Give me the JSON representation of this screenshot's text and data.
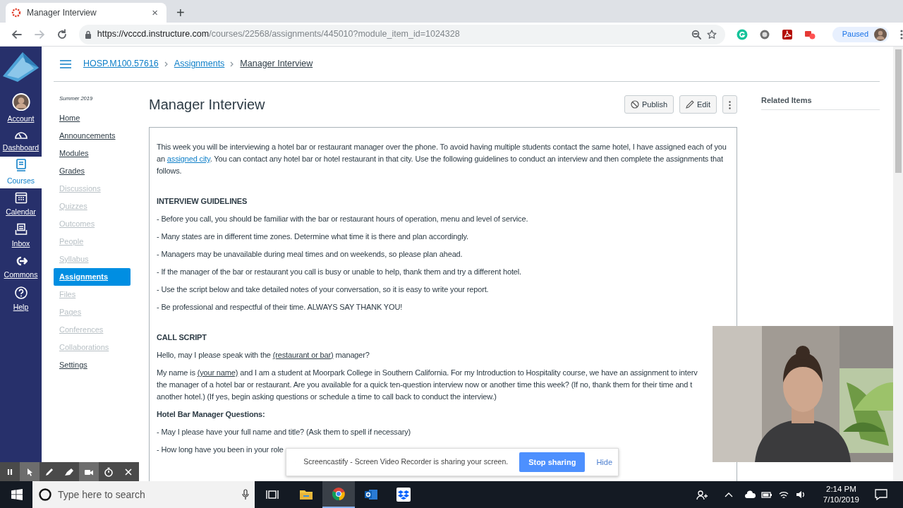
{
  "browser": {
    "tab": {
      "title": "Manager Interview",
      "close": "×"
    },
    "new_tab": "+",
    "url": {
      "host": "https://vcccd.instructure.com",
      "path": "/courses/22568/assignments/445010?module_item_id=1024328"
    },
    "profile_status": "Paused"
  },
  "global_nav": [
    {
      "label": "Account",
      "kind": "account",
      "selected": false
    },
    {
      "label": "Dashboard",
      "kind": "dashboard",
      "selected": false
    },
    {
      "label": "Courses",
      "kind": "courses",
      "selected": true
    },
    {
      "label": "Calendar",
      "kind": "calendar",
      "selected": false
    },
    {
      "label": "Inbox",
      "kind": "inbox",
      "selected": false
    },
    {
      "label": "Commons",
      "kind": "commons",
      "selected": false
    },
    {
      "label": "Help",
      "kind": "help",
      "selected": false
    }
  ],
  "breadcrumbs": [
    {
      "label": "HOSP.M100.57616",
      "current": false
    },
    {
      "label": "Assignments",
      "current": false
    },
    {
      "label": "Manager Interview",
      "current": true
    }
  ],
  "course_nav": {
    "term": "Summer 2019",
    "items": [
      {
        "label": "Home",
        "disabled": false,
        "selected": false
      },
      {
        "label": "Announcements",
        "disabled": false,
        "selected": false
      },
      {
        "label": "Modules",
        "disabled": false,
        "selected": false
      },
      {
        "label": "Grades",
        "disabled": false,
        "selected": false
      },
      {
        "label": "Discussions",
        "disabled": true,
        "selected": false
      },
      {
        "label": "Quizzes",
        "disabled": true,
        "selected": false
      },
      {
        "label": "Outcomes",
        "disabled": true,
        "selected": false
      },
      {
        "label": "People",
        "disabled": true,
        "selected": false
      },
      {
        "label": "Syllabus",
        "disabled": true,
        "selected": false
      },
      {
        "label": "Assignments",
        "disabled": false,
        "selected": true
      },
      {
        "label": "Files",
        "disabled": true,
        "selected": false
      },
      {
        "label": "Pages",
        "disabled": true,
        "selected": false
      },
      {
        "label": "Conferences",
        "disabled": true,
        "selected": false
      },
      {
        "label": "Collaborations",
        "disabled": true,
        "selected": false
      },
      {
        "label": "Settings",
        "disabled": false,
        "selected": false
      }
    ]
  },
  "assignment": {
    "title": "Manager Interview",
    "buttons": [
      {
        "kind": "publish",
        "label": "Publish"
      },
      {
        "kind": "edit",
        "label": "Edit"
      },
      {
        "kind": "more"
      }
    ],
    "body": [
      {
        "kind": "paragraph",
        "parts": [
          {
            "kind": "text",
            "text": "This week you will be interviewing a hotel bar or restaurant manager over the phone. To avoid having multiple students contact the same hotel, I have assigned each of you an "
          },
          {
            "kind": "link",
            "text": "assigned city"
          },
          {
            "kind": "text",
            "text": ". You can contact any hotel bar or hotel restaurant in that city. Use the following guidelines to conduct an interview and then complete the assignments that follows."
          }
        ]
      },
      {
        "kind": "section",
        "parts": [
          {
            "kind": "text",
            "text": "INTERVIEW GUIDELINES"
          }
        ]
      },
      {
        "kind": "item",
        "parts": [
          {
            "kind": "text",
            "text": "- Before you call, you should be familiar with the bar or restaurant hours of operation, menu and level of service."
          }
        ]
      },
      {
        "kind": "item",
        "parts": [
          {
            "kind": "text",
            "text": "- Many states are in different time zones. Determine what time it is there and plan accordingly."
          }
        ]
      },
      {
        "kind": "item",
        "parts": [
          {
            "kind": "text",
            "text": "- Managers may be unavailable during meal times and on weekends, so please plan ahead."
          }
        ]
      },
      {
        "kind": "item",
        "parts": [
          {
            "kind": "text",
            "text": "- If the manager of the bar or restaurant you call is busy or unable to help, thank them and try a different hotel."
          }
        ]
      },
      {
        "kind": "item",
        "parts": [
          {
            "kind": "text",
            "text": "- Use the script below and take detailed notes of your conversation, so it is easy to write your report."
          }
        ]
      },
      {
        "kind": "item",
        "parts": [
          {
            "kind": "text",
            "text": "- Be professional and respectful of their time. ALWAYS SAY THANK YOU!"
          }
        ]
      },
      {
        "kind": "section",
        "parts": [
          {
            "kind": "text",
            "text": "CALL SCRIPT"
          }
        ]
      },
      {
        "kind": "item",
        "parts": [
          {
            "kind": "text",
            "text": "Hello, may I please speak with the "
          },
          {
            "kind": "underline",
            "text": "(restaurant or bar)"
          },
          {
            "kind": "text",
            "text": " manager?"
          }
        ]
      },
      {
        "kind": "lines",
        "lines": [
          [
            {
              "kind": "text",
              "text": "My name is "
            },
            {
              "kind": "underline",
              "text": "(your name)"
            },
            {
              "kind": "text",
              "text": " and I am a student at Moorpark College in Southern California. For my Introduction to Hospitality course, we have an assignment to interv"
            }
          ],
          [
            {
              "kind": "text",
              "text": "the manager of a hotel bar or restaurant. Are you available for a quick ten-question interview now or another time this week? (If no, thank them for their time and t"
            }
          ],
          [
            {
              "kind": "text",
              "text": "another hotel.) (If yes, begin asking questions or schedule a time to call back to conduct the interview.)"
            }
          ]
        ]
      },
      {
        "kind": "subheading",
        "parts": [
          {
            "kind": "text",
            "text": "Hotel Bar Manager Questions:"
          }
        ]
      },
      {
        "kind": "item",
        "parts": [
          {
            "kind": "text",
            "text": "- May I please have your full name and title? (Ask them to spell if necessary)"
          }
        ]
      },
      {
        "kind": "item",
        "parts": [
          {
            "kind": "text",
            "text": "- How long have you been in your role"
          }
        ]
      }
    ]
  },
  "related": {
    "title": "Related Items"
  },
  "recorder_tools": [
    {
      "kind": "pause",
      "on": false
    },
    {
      "kind": "cursor",
      "on": true
    },
    {
      "kind": "pen",
      "on": false
    },
    {
      "kind": "highlighter",
      "on": false
    },
    {
      "kind": "camera",
      "on": true
    },
    {
      "kind": "timer",
      "on": false
    },
    {
      "kind": "close",
      "on": false
    }
  ],
  "share_bar": {
    "message": "Screencastify - Screen Video Recorder is sharing your screen.",
    "stop": "Stop sharing",
    "hide": "Hide"
  },
  "taskbar": {
    "search_placeholder": "Type here to search",
    "apps": [
      {
        "kind": "explorer",
        "active": false
      },
      {
        "kind": "chrome",
        "active": true
      },
      {
        "kind": "outlook",
        "active": false
      },
      {
        "kind": "dropbox",
        "active": false
      }
    ],
    "time": "2:14 PM",
    "date": "7/10/2019"
  }
}
